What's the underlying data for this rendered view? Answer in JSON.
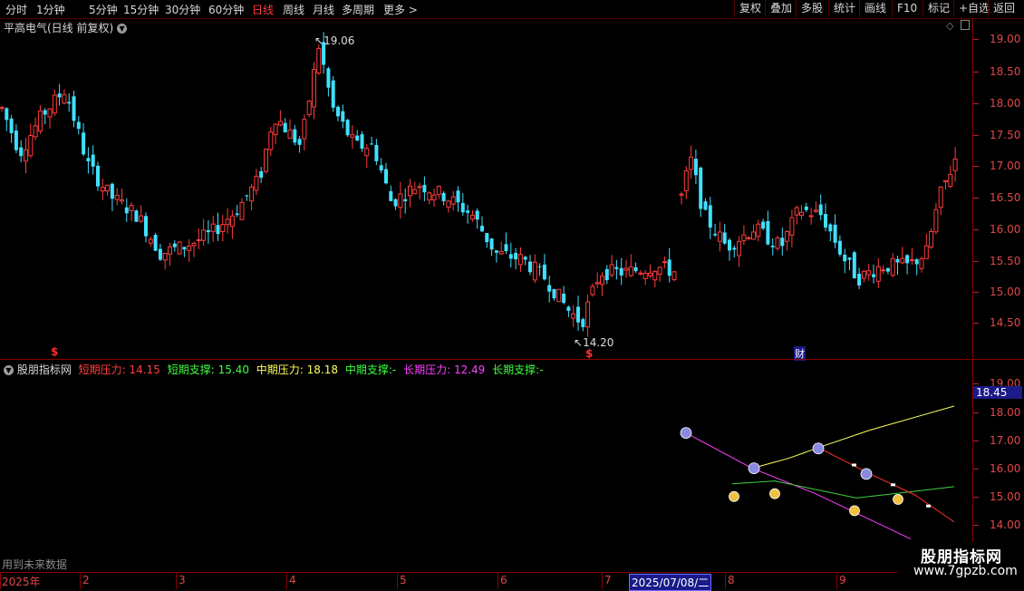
{
  "toolbar": {
    "periods": [
      "分时",
      "1分钟",
      "5分钟",
      "15分钟",
      "30分钟",
      "60分钟",
      "日线",
      "周线",
      "月线",
      "多周期",
      "更多 >"
    ],
    "active_period": "日线",
    "right_buttons": [
      "复权",
      "叠加",
      "多股",
      "统计",
      "画线",
      "F10",
      "标记",
      "+自选",
      "返回"
    ]
  },
  "main_chart": {
    "title": "平高电气(日线 前复权)",
    "high_label": "19.06",
    "low_label": "14.20",
    "marker_s1": "$",
    "marker_s2": "$",
    "marker_cai": "财",
    "price_ticks": [
      "19.00",
      "18.50",
      "18.00",
      "17.50",
      "17.00",
      "16.50",
      "16.00",
      "15.50",
      "15.00",
      "14.50"
    ]
  },
  "indicator": {
    "name": "股朋指标网",
    "items": [
      {
        "label": "短期压力:",
        "value": "14.15",
        "color": "#ff4040"
      },
      {
        "label": "短期支撑:",
        "value": "15.40",
        "color": "#40ff40"
      },
      {
        "label": "中期压力:",
        "value": "18.18",
        "color": "#ffff60"
      },
      {
        "label": "中期支撑:",
        "value": "-",
        "color": "#40ff40"
      },
      {
        "label": "长期压力:",
        "value": "12.49",
        "color": "#ff40ff"
      },
      {
        "label": "长期支撑:",
        "value": "-",
        "color": "#40ff40"
      }
    ],
    "axis_ticks": [
      "19.00",
      "18.00",
      "17.00",
      "16.00",
      "15.00",
      "14.00"
    ],
    "cursor_value": "18.45",
    "future_note": "用到未来数据"
  },
  "date_axis": {
    "labels": [
      "2025年",
      "2",
      "3",
      "4",
      "5",
      "6",
      "7",
      "8",
      "9"
    ],
    "cursor_date": "2025/07/08/二"
  },
  "watermark": {
    "title": "股朋指标网",
    "url": "www.7gpzb.com"
  },
  "colors": {
    "up": "#ff3c3c",
    "down": "#40e0ff",
    "axis": "#e04848",
    "border": "#8a0000"
  }
}
